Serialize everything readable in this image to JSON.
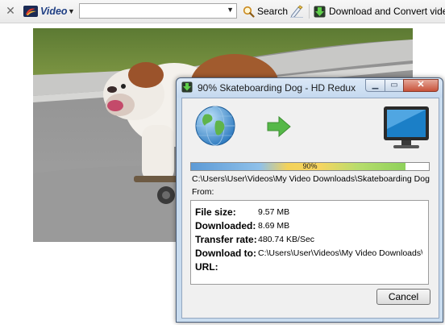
{
  "toolbar": {
    "brand": "Video",
    "search_value": "",
    "search_label": "Search",
    "download_label": "Download and Convert video"
  },
  "dialog": {
    "title": "90% Skateboarding Dog - HD Redux",
    "progress_percent": 90,
    "progress_label": "90%",
    "path_line": "C:\\Users\\User\\Videos\\My Video Downloads\\Skateboarding Dog -",
    "from_label": "From:",
    "fields": {
      "file_size": {
        "label": "File size:",
        "value": "9.57 MB"
      },
      "downloaded": {
        "label": "Downloaded:",
        "value": "8.69 MB"
      },
      "transfer_rate": {
        "label": "Transfer rate:",
        "value": "480.74 KB/Sec"
      },
      "download_to": {
        "label": "Download to:",
        "value": "C:\\Users\\User\\Videos\\My Video Downloads\\Sk"
      },
      "url": {
        "label": "URL:",
        "value": ""
      }
    },
    "cancel_label": "Cancel"
  },
  "colors": {
    "brand": "#1f3f84",
    "progress_blue": "#5c9ad6",
    "progress_yellow": "#f3d25a",
    "progress_green": "#8ed15b",
    "arrow_green": "#55b848"
  },
  "icons": [
    "close-icon",
    "video-logo-icon",
    "chevron-down-icon",
    "search-icon",
    "pen-icon",
    "download-icon",
    "app-icon",
    "minimize-icon",
    "maximize-icon",
    "window-close-icon",
    "globe-icon",
    "arrow-right-icon",
    "monitor-icon"
  ]
}
